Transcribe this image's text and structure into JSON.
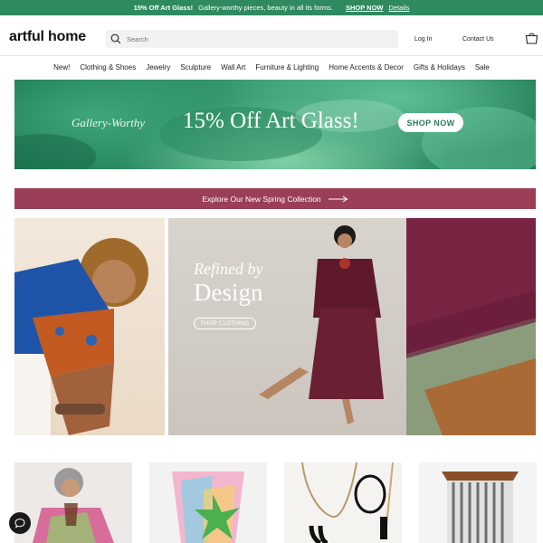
{
  "promo": {
    "headline": "15% Off Art Glass!",
    "text": "Gallery-worthy pieces, beauty in all its forms.",
    "shop_now": "SHOP NOW",
    "details": "Details"
  },
  "header": {
    "logo": "artful home",
    "search_placeholder": "Search",
    "login": "Log In",
    "contact": "Contact Us",
    "cart_icon": "shopping-bag-icon"
  },
  "nav": {
    "items": [
      "New!",
      "Clothing & Shoes",
      "Jewelry",
      "Sculpture",
      "Wall Art",
      "Furniture & Lighting",
      "Home Accents & Decor",
      "Gifts & Holidays",
      "Sale"
    ]
  },
  "hero": {
    "kicker": "Gallery-Worthy",
    "headline": "15% Off Art Glass!",
    "button": "SHOP NOW",
    "button_color": "#2b7e58"
  },
  "spring_banner": {
    "label": "Explore Our New Spring Collection",
    "color": "#9b3f58"
  },
  "feature": {
    "line1": "Refined by",
    "line2": "Design",
    "button": "SHOP CLOTHING"
  },
  "colors": {
    "promo_bg": "#2f8a5f",
    "accent_plum": "#7c2446"
  },
  "chat": {
    "icon": "chat-bubble-icon"
  }
}
